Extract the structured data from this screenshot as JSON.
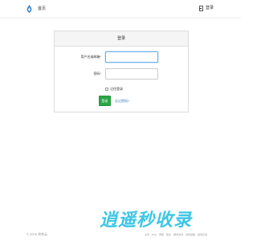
{
  "header": {
    "brand_label": "首页",
    "login_label": "登录"
  },
  "login_panel": {
    "title": "登录",
    "username_label": "用户名或邮箱*",
    "username_value": "",
    "password_label": "密码*",
    "password_value": "",
    "remember_label": "记住登录",
    "remember_checked": false,
    "submit_label": "登录",
    "forgot_label": "忘记密码?"
  },
  "footer": {
    "copyright": "© 2005 帅帅云",
    "links": [
      "主页",
      "FAQ",
      "博客",
      "联系",
      "服务条款",
      "隐私政策",
      "提供反馈"
    ]
  },
  "watermark": {
    "text": "逍遥秒收录"
  },
  "colors": {
    "primary_button": "#28a745",
    "link": "#337ab7",
    "watermark": "#3dc6e6",
    "brand_logo": "#2f7fd0"
  }
}
